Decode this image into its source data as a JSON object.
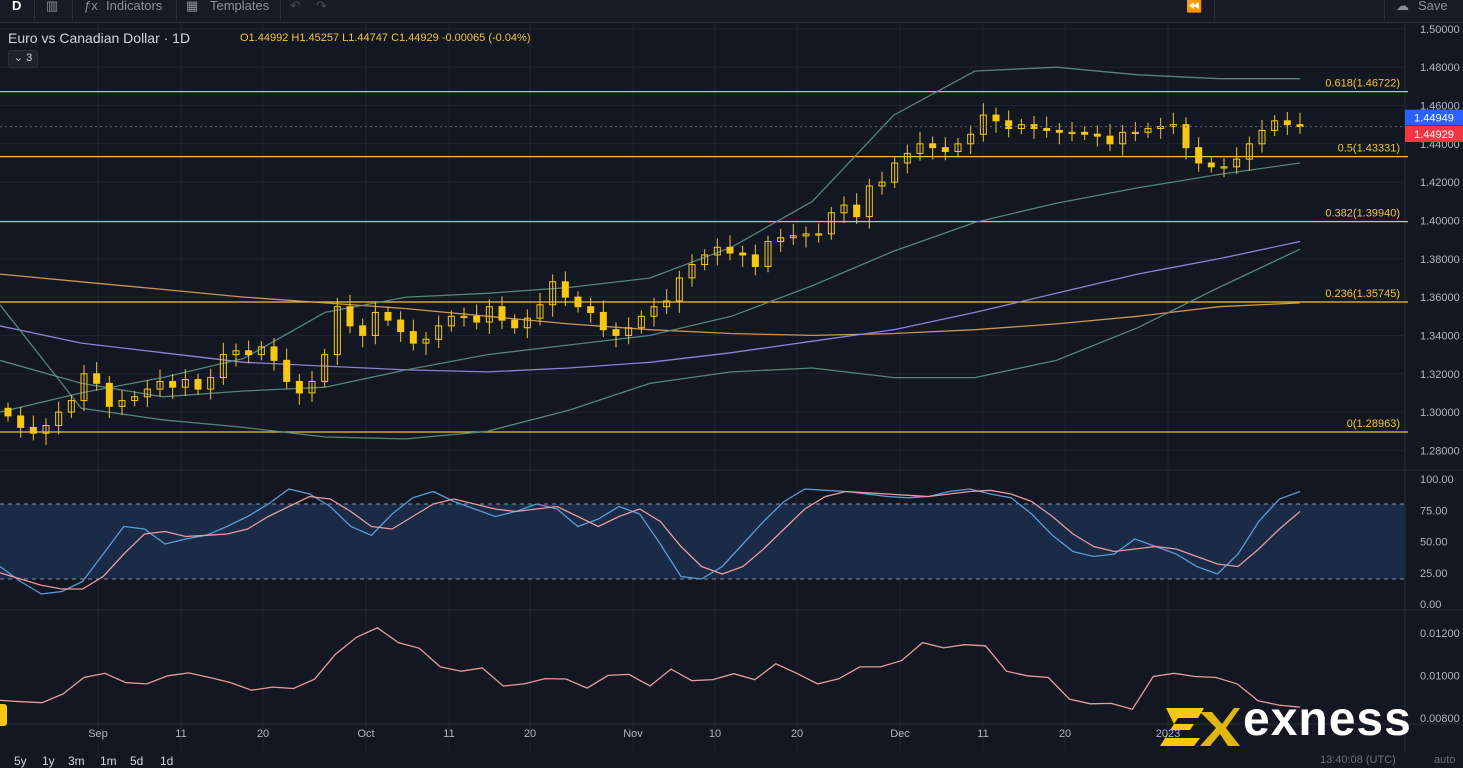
{
  "toolbar": {
    "interval": "D",
    "indicators_label": "Indicators",
    "templates_label": "Templates",
    "save_label": "Save"
  },
  "legend": {
    "symbol": "Euro vs Canadian Dollar · 1D",
    "ohlc": "O1.44992 H1.45257 L1.44747 C1.44929 -0.00065 (-0.04%)",
    "collapse": "⌄ 3"
  },
  "bottom": {
    "ranges": [
      "5y",
      "1y",
      "3m",
      "1m",
      "5d",
      "1d"
    ],
    "clock": "13:40:08 (UTC)",
    "auto": "auto"
  },
  "brand": {
    "name": "exness",
    "color": "#f7c80f"
  },
  "chart_data": [
    {
      "type": "candlestick",
      "title": "Euro vs Canadian Dollar · 1D",
      "ylim": [
        1.275,
        1.502
      ],
      "y_ticks": [
        "1.50000",
        "1.48000",
        "1.46000",
        "1.44000",
        "1.42000",
        "1.40000",
        "1.38000",
        "1.36000",
        "1.34000",
        "1.32000",
        "1.30000",
        "1.28000"
      ],
      "x_ticks": [
        "Sep",
        "11",
        "20",
        "Oct",
        "11",
        "20",
        "Nov",
        "10",
        "20",
        "Dec",
        "11",
        "20",
        "2023"
      ],
      "price_labels": [
        {
          "value": "1.44949",
          "color": "#2962ff"
        },
        {
          "value": "1.44929",
          "color": "#f23645"
        }
      ],
      "fib_levels": [
        {
          "label": "0.618(1.46722)",
          "value": 1.46722
        },
        {
          "label": "0.5(1.43331)",
          "value": 1.43331
        },
        {
          "label": "0.382(1.39940)",
          "value": 1.3994
        },
        {
          "label": "0.236(1.35745)",
          "value": 1.35745
        },
        {
          "label": "0(1.28963)",
          "value": 1.28963
        }
      ],
      "closes": [
        1.298,
        1.292,
        1.289,
        1.293,
        1.3,
        1.306,
        1.32,
        1.315,
        1.303,
        1.306,
        1.308,
        1.312,
        1.316,
        1.313,
        1.317,
        1.312,
        1.318,
        1.33,
        1.332,
        1.33,
        1.334,
        1.327,
        1.316,
        1.31,
        1.316,
        1.33,
        1.355,
        1.345,
        1.34,
        1.352,
        1.348,
        1.342,
        1.336,
        1.338,
        1.345,
        1.35,
        1.35,
        1.347,
        1.355,
        1.348,
        1.344,
        1.349,
        1.356,
        1.368,
        1.36,
        1.355,
        1.352,
        1.343,
        1.34,
        1.344,
        1.35,
        1.355,
        1.358,
        1.37,
        1.377,
        1.382,
        1.386,
        1.383,
        1.382,
        1.376,
        1.389,
        1.391,
        1.392,
        1.393,
        1.393,
        1.404,
        1.408,
        1.402,
        1.418,
        1.42,
        1.43,
        1.435,
        1.44,
        1.438,
        1.436,
        1.44,
        1.445,
        1.455,
        1.452,
        1.448,
        1.45,
        1.448,
        1.447,
        1.446,
        1.446,
        1.445,
        1.444,
        1.44,
        1.446,
        1.446,
        1.448,
        1.449,
        1.45,
        1.438,
        1.43,
        1.428,
        1.428,
        1.432,
        1.44,
        1.447,
        1.452,
        1.45,
        1.449
      ],
      "moving_averages": [
        {
          "name": "MA orange",
          "color": "#e0a15e",
          "values": [
            1.372,
            1.368,
            1.364,
            1.36,
            1.357,
            1.354,
            1.35,
            1.346,
            1.343,
            1.341,
            1.34,
            1.341,
            1.343,
            1.346,
            1.35,
            1.355,
            1.357
          ]
        },
        {
          "name": "MA purple",
          "color": "#9b8de8",
          "values": [
            1.345,
            1.336,
            1.331,
            1.326,
            1.324,
            1.322,
            1.321,
            1.323,
            1.326,
            1.331,
            1.337,
            1.343,
            1.352,
            1.362,
            1.372,
            1.38,
            1.389
          ]
        },
        {
          "name": "Bollinger upper",
          "color": "#5d8f83",
          "values": [
            1.3,
            1.31,
            1.318,
            1.328,
            1.352,
            1.36,
            1.362,
            1.365,
            1.37,
            1.386,
            1.41,
            1.455,
            1.478,
            1.48,
            1.476,
            1.474,
            1.474
          ]
        },
        {
          "name": "Bollinger middle",
          "color": "#5d8f83",
          "values": [
            1.327,
            1.315,
            1.308,
            1.311,
            1.313,
            1.322,
            1.33,
            1.335,
            1.34,
            1.35,
            1.366,
            1.384,
            1.399,
            1.409,
            1.417,
            1.424,
            1.43
          ]
        },
        {
          "name": "Bollinger lower",
          "color": "#5d8f83",
          "values": [
            1.356,
            1.302,
            1.296,
            1.292,
            1.287,
            1.286,
            1.29,
            1.301,
            1.315,
            1.321,
            1.323,
            1.318,
            1.318,
            1.327,
            1.344,
            1.365,
            1.385
          ]
        }
      ]
    },
    {
      "type": "line",
      "title": "",
      "ylim": [
        0,
        100
      ],
      "y_ticks": [
        "100.00",
        "75.00",
        "50.00",
        "25.00",
        "0.00"
      ],
      "band": [
        20,
        80
      ],
      "series": [
        {
          "color": "#5b9bd5",
          "values": [
            30,
            18,
            8,
            10,
            18,
            40,
            62,
            60,
            48,
            52,
            55,
            62,
            70,
            80,
            92,
            88,
            78,
            62,
            55,
            72,
            85,
            90,
            82,
            76,
            70,
            74,
            80,
            76,
            62,
            68,
            78,
            72,
            48,
            22,
            20,
            30,
            48,
            66,
            82,
            92,
            91,
            90,
            88,
            86,
            85,
            86,
            90,
            92,
            88,
            85,
            72,
            55,
            42,
            38,
            40,
            52,
            46,
            40,
            30,
            24,
            40,
            66,
            84,
            90
          ]
        },
        {
          "color": "#e79aa0",
          "values": [
            25,
            20,
            15,
            12,
            12,
            22,
            40,
            56,
            58,
            54,
            55,
            56,
            60,
            70,
            78,
            86,
            84,
            74,
            62,
            60,
            70,
            80,
            84,
            80,
            76,
            74,
            76,
            78,
            70,
            62,
            70,
            76,
            66,
            46,
            30,
            24,
            30,
            44,
            60,
            76,
            86,
            90,
            89,
            88,
            87,
            86,
            88,
            90,
            91,
            88,
            82,
            70,
            56,
            46,
            42,
            44,
            46,
            44,
            38,
            32,
            30,
            44,
            60,
            74
          ]
        }
      ]
    },
    {
      "type": "line",
      "title": "",
      "y_ticks": [
        "0.01200",
        "0.01000",
        "0.00800"
      ],
      "series": [
        {
          "color": "#e79aa0",
          "values": [
            0.00882,
            0.00876,
            0.00871,
            0.00912,
            0.0099,
            0.0101,
            0.00966,
            0.0096,
            0.00998,
            0.01012,
            0.0099,
            0.00966,
            0.0093,
            0.00945,
            0.00938,
            0.00982,
            0.011,
            0.0118,
            0.01225,
            0.01155,
            0.01128,
            0.0104,
            0.0102,
            0.01035,
            0.0095,
            0.0096,
            0.00985,
            0.00983,
            0.0094,
            0.01,
            0.01005,
            0.0095,
            0.0103,
            0.00975,
            0.0098,
            0.01008,
            0.0098,
            0.01055,
            0.0101,
            0.0096,
            0.00984,
            0.0104,
            0.0104,
            0.0107,
            0.01155,
            0.0113,
            0.01145,
            0.0114,
            0.0102,
            0.00998,
            0.0099,
            0.00888,
            0.00866,
            0.00868,
            0.0084,
            0.00995,
            0.0101,
            0.00995,
            0.0099,
            0.0096,
            0.0088,
            0.0086,
            0.0085
          ]
        }
      ]
    }
  ]
}
